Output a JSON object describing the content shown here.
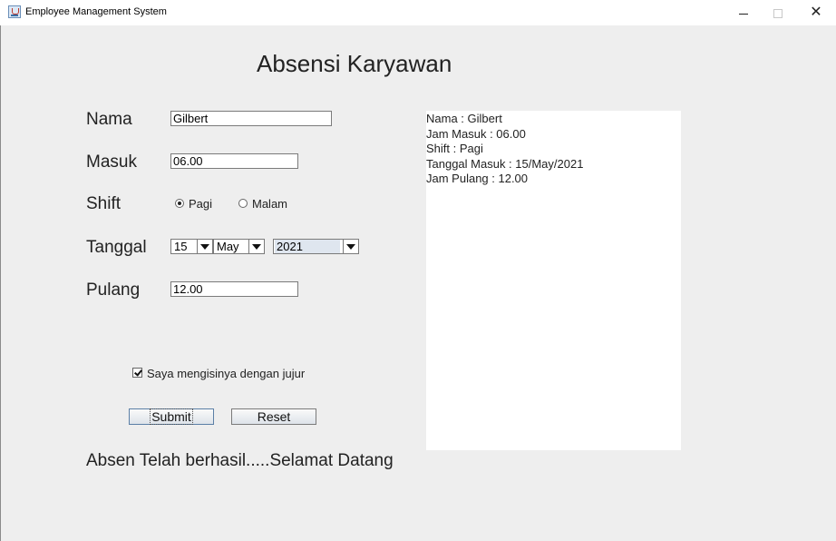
{
  "window": {
    "title": "Employee Management System",
    "minimize_icon": "minimize-icon",
    "maximize_icon": "maximize-icon",
    "close_icon": "close-icon",
    "close_glyph": "✕"
  },
  "form": {
    "heading": "Absensi Karyawan",
    "labels": {
      "nama": "Nama",
      "masuk": "Masuk",
      "shift": "Shift",
      "tanggal": "Tanggal",
      "pulang": "Pulang"
    },
    "nama_value": "Gilbert",
    "masuk_value": "06.00",
    "pulang_value": "12.00",
    "shift_options": [
      "Pagi",
      "Malam"
    ],
    "shift_selected": "Pagi",
    "tanggal": {
      "day": "15",
      "month": "May",
      "year": "2021"
    },
    "checkbox_label": "Saya mengisinya dengan jujur",
    "checkbox_checked": true,
    "submit_label": "Submit",
    "reset_label": "Reset",
    "status_message": "Absen Telah berhasil.....Selamat Datang"
  },
  "output": {
    "lines": [
      "Nama : Gilbert",
      "Jam Masuk : 06.00",
      "Shift : Pagi",
      "Tanggal Masuk : 15/May/2021",
      "Jam Pulang : 12.00"
    ]
  }
}
